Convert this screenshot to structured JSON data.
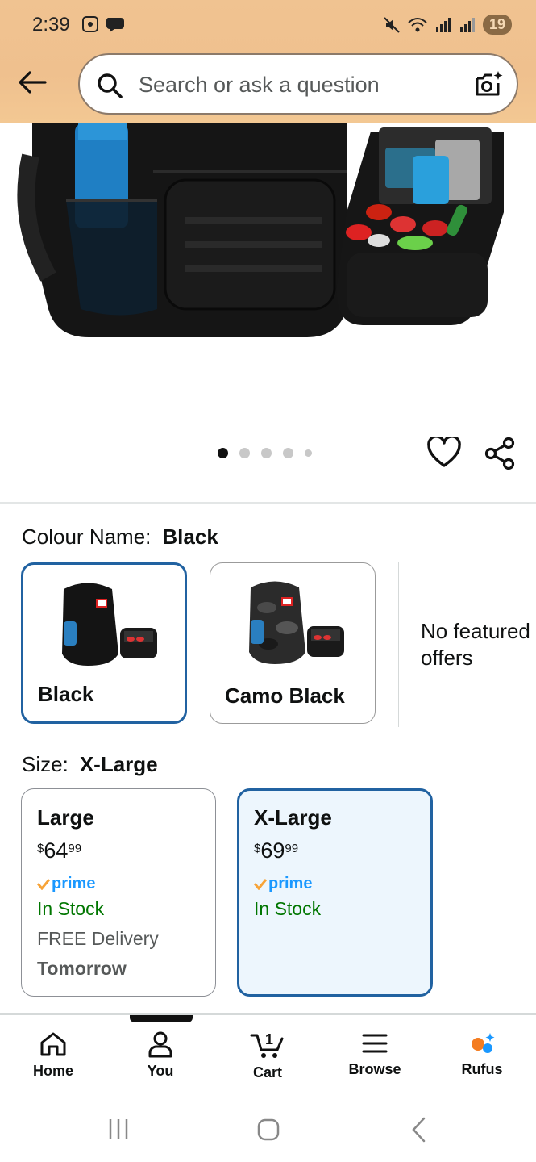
{
  "status_bar": {
    "time": "2:39",
    "battery": "19"
  },
  "header": {
    "search_placeholder": "Search or ask a question"
  },
  "gallery": {
    "dots_total": 5,
    "active_index": 0
  },
  "colour": {
    "label": "Colour Name:",
    "selected": "Black",
    "options": [
      {
        "name": "Black",
        "selected": true
      },
      {
        "name": "Camo Black",
        "selected": false
      }
    ],
    "no_featured_offers": [
      "No featured",
      "offers"
    ]
  },
  "size": {
    "label": "Size:",
    "selected": "X-Large",
    "options": [
      {
        "name": "Large",
        "price_symbol": "$",
        "price_whole": "64",
        "price_fraction": "99",
        "prime": "prime",
        "stock": "In Stock",
        "delivery": "FREE Delivery",
        "delivery_when": "Tomorrow",
        "selected": false
      },
      {
        "name": "X-Large",
        "price_symbol": "$",
        "price_whole": "69",
        "price_fraction": "99",
        "prime": "prime",
        "stock": "In Stock",
        "selected": true
      }
    ]
  },
  "bottom_nav": {
    "items": [
      {
        "label": "Home",
        "icon": "home-icon"
      },
      {
        "label": "You",
        "icon": "person-icon"
      },
      {
        "label": "Cart",
        "icon": "cart-icon",
        "badge": "1"
      },
      {
        "label": "Browse",
        "icon": "menu-icon"
      },
      {
        "label": "Rufus",
        "icon": "rufus-icon"
      }
    ]
  },
  "colors": {
    "header_bg": "#f0c391",
    "selected_border": "#2162a1",
    "in_stock": "#007600",
    "prime_blue": "#1a98ff",
    "prime_check": "#f7a337"
  }
}
